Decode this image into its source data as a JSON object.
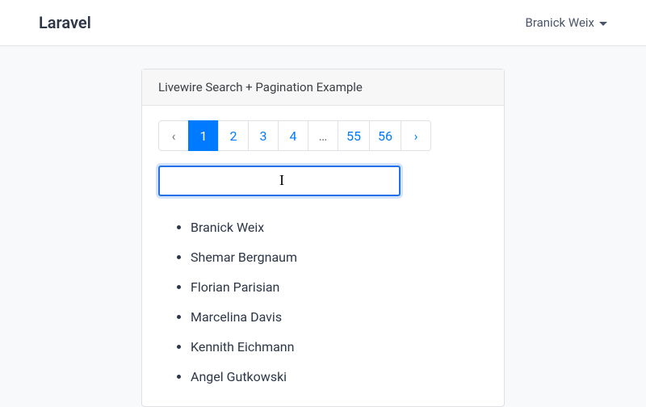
{
  "navbar": {
    "brand": "Laravel",
    "user_name": "Branick Weix"
  },
  "card": {
    "title": "Livewire Search + Pagination Example"
  },
  "pagination": {
    "prev": "‹",
    "pages": [
      "1",
      "2",
      "3",
      "4",
      "…",
      "55",
      "56"
    ],
    "active_index": 0,
    "next": "›"
  },
  "search": {
    "value": "",
    "placeholder": ""
  },
  "results": [
    "Branick Weix",
    "Shemar Bergnaum",
    "Florian Parisian",
    "Marcelina Davis",
    "Kennith Eichmann",
    "Angel Gutkowski"
  ]
}
